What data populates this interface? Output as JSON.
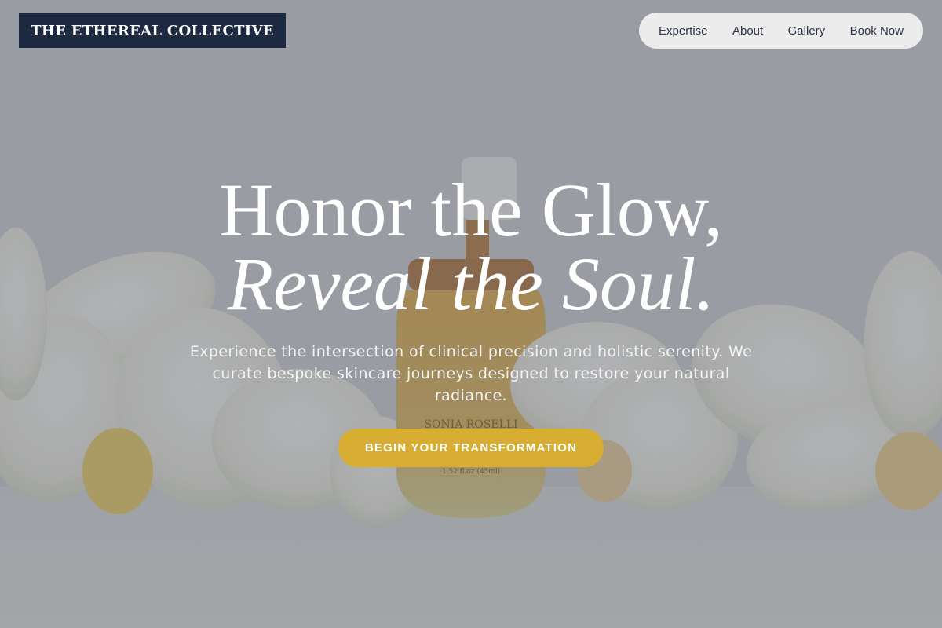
{
  "brand": {
    "logo_text": "THE ETHEREAL COLLECTIVE",
    "logo_bg": "#1e2a42"
  },
  "nav": {
    "items": [
      {
        "label": "Expertise"
      },
      {
        "label": "About"
      },
      {
        "label": "Gallery"
      },
      {
        "label": "Book Now"
      }
    ]
  },
  "hero": {
    "headline_line1": "Honor the Glow,",
    "headline_line2": "Reveal the Soul.",
    "subtext": "Experience the intersection of clinical precision and holistic serenity. We curate bespoke skincare journeys designed to restore your natural radiance.",
    "cta_label": "BEGIN YOUR TRANSFORMATION",
    "cta_color": "#d8ae32"
  },
  "background": {
    "description_icon": "serum-bottle-with-orchids-photo",
    "product_label_text": [
      "SONIA ROSELLI",
      "1.52 fl.oz (45ml)"
    ]
  }
}
